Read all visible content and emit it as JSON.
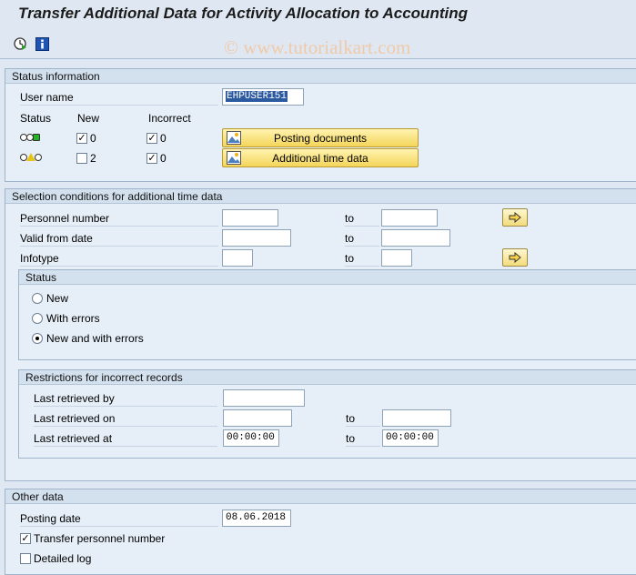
{
  "header": {
    "title": "Transfer Additional Data for Activity Allocation to Accounting",
    "watermark": "© www.tutorialkart.com"
  },
  "toolbar": {
    "execute_icon": "clock-execute-icon",
    "info_icon": "info-icon"
  },
  "status_info": {
    "title": "Status information",
    "user_label": "User name",
    "user_value": "EHPUSER151",
    "col_status": "Status",
    "col_new": "New",
    "col_incorrect": "Incorrect",
    "rows": [
      {
        "new_checked": true,
        "new_count": "0",
        "incorrect_checked": true,
        "incorrect_count": "0",
        "button": "Posting documents"
      },
      {
        "new_checked": false,
        "new_count": "2",
        "incorrect_checked": true,
        "incorrect_count": "0",
        "button": "Additional time data"
      }
    ]
  },
  "selection": {
    "title": "Selection conditions for additional time data",
    "personnel_label": "Personnel number",
    "valid_from_label": "Valid from date",
    "infotype_label": "Infotype",
    "to_label": "to",
    "status_group": {
      "title": "Status",
      "options": [
        "New",
        "With errors",
        "New and with errors"
      ],
      "selected_index": 2
    },
    "restrictions": {
      "title": "Restrictions for incorrect records",
      "retrieved_by_label": "Last retrieved by",
      "retrieved_on_label": "Last retrieved on",
      "retrieved_at_label": "Last retrieved at",
      "retrieved_at_from": "00:00:00",
      "retrieved_at_to": "00:00:00",
      "to_label": "to"
    }
  },
  "other": {
    "title": "Other data",
    "posting_date_label": "Posting date",
    "posting_date_value": "08.06.2018",
    "transfer_label": "Transfer personnel number",
    "transfer_checked": true,
    "detailed_log_label": "Detailed log",
    "detailed_log_checked": false
  },
  "colors": {
    "background": "#dfe8f2",
    "button_yellow": "#f4d55a",
    "light_green": "#22b422",
    "light_yellow": "#f6e21a"
  }
}
